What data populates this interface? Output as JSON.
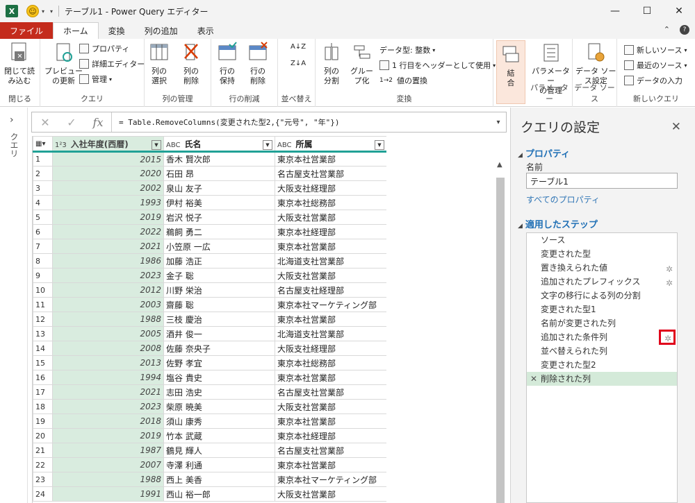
{
  "window": {
    "title": "テーブル1 - Power Query エディター",
    "app_icon": "X"
  },
  "tabs": [
    "ファイル",
    "ホーム",
    "変換",
    "列の追加",
    "表示"
  ],
  "ribbon": {
    "close_load": [
      "閉じて読",
      "み込む"
    ],
    "close_group": "閉じる",
    "preview_refresh": [
      "プレビュー",
      "の更新"
    ],
    "properties": "プロパティ",
    "advanced_editor": "詳細エディター",
    "manage": "管理",
    "query_group": "クエリ",
    "choose_columns": [
      "列の",
      "選択"
    ],
    "remove_columns": [
      "列の",
      "削除"
    ],
    "column_mgmt_group": "列の管理",
    "keep_rows": [
      "行の",
      "保持"
    ],
    "remove_rows": [
      "行の",
      "削除"
    ],
    "row_reduce_group": "行の削減",
    "sort_group": "並べ替え",
    "split_column": [
      "列の",
      "分割"
    ],
    "group_by": [
      "グルー",
      "プ化"
    ],
    "data_type": "データ型: 整数",
    "use_first_row": "1 行目をヘッダーとして使用",
    "replace_values": "値の置換",
    "transform_group": "変換",
    "combine": [
      "結",
      "合"
    ],
    "manage_params": [
      "パラメーター",
      "の管理"
    ],
    "params_group": "パラメーター",
    "data_source_settings": [
      "データ ソー",
      "ス設定"
    ],
    "data_source_group": "データ ソース",
    "new_source": "新しいソース",
    "recent_sources": "最近のソース",
    "enter_data": "データの入力",
    "new_query_group": "新しいクエリ"
  },
  "left_strip": {
    "label": "クエリ"
  },
  "formula_bar": {
    "fx": "fx",
    "formula": "= Table.RemoveColumns(変更された型2,{\"元号\", \"年\"})"
  },
  "grid": {
    "headers": [
      {
        "type": "1²3",
        "label": "入社年度(西暦)"
      },
      {
        "type": "ABC",
        "label": "氏名"
      },
      {
        "type": "ABC",
        "label": "所属"
      }
    ],
    "rows": [
      [
        "1",
        "2015",
        "香木 賢次郎",
        "東京本社営業部"
      ],
      [
        "2",
        "2020",
        "石田 昂",
        "名古屋支社営業部"
      ],
      [
        "3",
        "2002",
        "泉山 友子",
        "大阪支社経理部"
      ],
      [
        "4",
        "1993",
        "伊村 裕美",
        "東京本社総務部"
      ],
      [
        "5",
        "2019",
        "岩沢 悦子",
        "大阪支社営業部"
      ],
      [
        "6",
        "2022",
        "鵜飼 勇二",
        "東京本社経理部"
      ],
      [
        "7",
        "2021",
        "小笠原 一広",
        "東京本社営業部"
      ],
      [
        "8",
        "1986",
        "加藤 浩正",
        "北海道支社営業部"
      ],
      [
        "9",
        "2023",
        "金子 聡",
        "大阪支社営業部"
      ],
      [
        "10",
        "2012",
        "川野 栄治",
        "名古屋支社経理部"
      ],
      [
        "11",
        "2003",
        "齋藤 聡",
        "東京本社マーケティング部"
      ],
      [
        "12",
        "1988",
        "三枝 慶治",
        "東京本社営業部"
      ],
      [
        "13",
        "2005",
        "酒井 俊一",
        "北海道支社営業部"
      ],
      [
        "14",
        "2008",
        "佐藤 奈央子",
        "大阪支社経理部"
      ],
      [
        "15",
        "2013",
        "佐野 孝宜",
        "東京本社総務部"
      ],
      [
        "16",
        "1994",
        "塩谷 貴史",
        "東京本社営業部"
      ],
      [
        "17",
        "2021",
        "志田 浩史",
        "名古屋支社営業部"
      ],
      [
        "18",
        "2023",
        "柴原 暁美",
        "大阪支社営業部"
      ],
      [
        "19",
        "2018",
        "須山 康秀",
        "東京本社営業部"
      ],
      [
        "20",
        "2019",
        "竹本 武蔵",
        "東京本社経理部"
      ],
      [
        "21",
        "1987",
        "鶴見 輝人",
        "名古屋支社営業部"
      ],
      [
        "22",
        "2007",
        "寺澤 利通",
        "東京本社営業部"
      ],
      [
        "23",
        "1988",
        "西上 美香",
        "東京本社マーケティング部"
      ],
      [
        "24",
        "1991",
        "西山 裕一郎",
        "大阪支社営業部"
      ]
    ]
  },
  "pane": {
    "title": "クエリの設定",
    "properties_heading": "プロパティ",
    "name_label": "名前",
    "name_value": "テーブル1",
    "all_properties": "すべてのプロパティ",
    "steps_heading": "適用したステップ",
    "steps": [
      {
        "label": "ソース",
        "gear": false
      },
      {
        "label": "変更された型",
        "gear": false
      },
      {
        "label": "置き換えられた値",
        "gear": true
      },
      {
        "label": "追加されたプレフィックス",
        "gear": true
      },
      {
        "label": "文字の移行による列の分割",
        "gear": false
      },
      {
        "label": "変更された型1",
        "gear": false
      },
      {
        "label": "名前が変更された列",
        "gear": false
      },
      {
        "label": "追加された条件列",
        "gear": true,
        "highlight": true
      },
      {
        "label": "並べ替えられた列",
        "gear": false
      },
      {
        "label": "変更された型2",
        "gear": false
      },
      {
        "label": "削除された列",
        "gear": false,
        "selected": true
      }
    ]
  },
  "colors": {
    "accent": "#21a196",
    "file_tab": "#c42b1c",
    "highlight_border": "#e0001b",
    "selected_step": "#d4ead9"
  }
}
